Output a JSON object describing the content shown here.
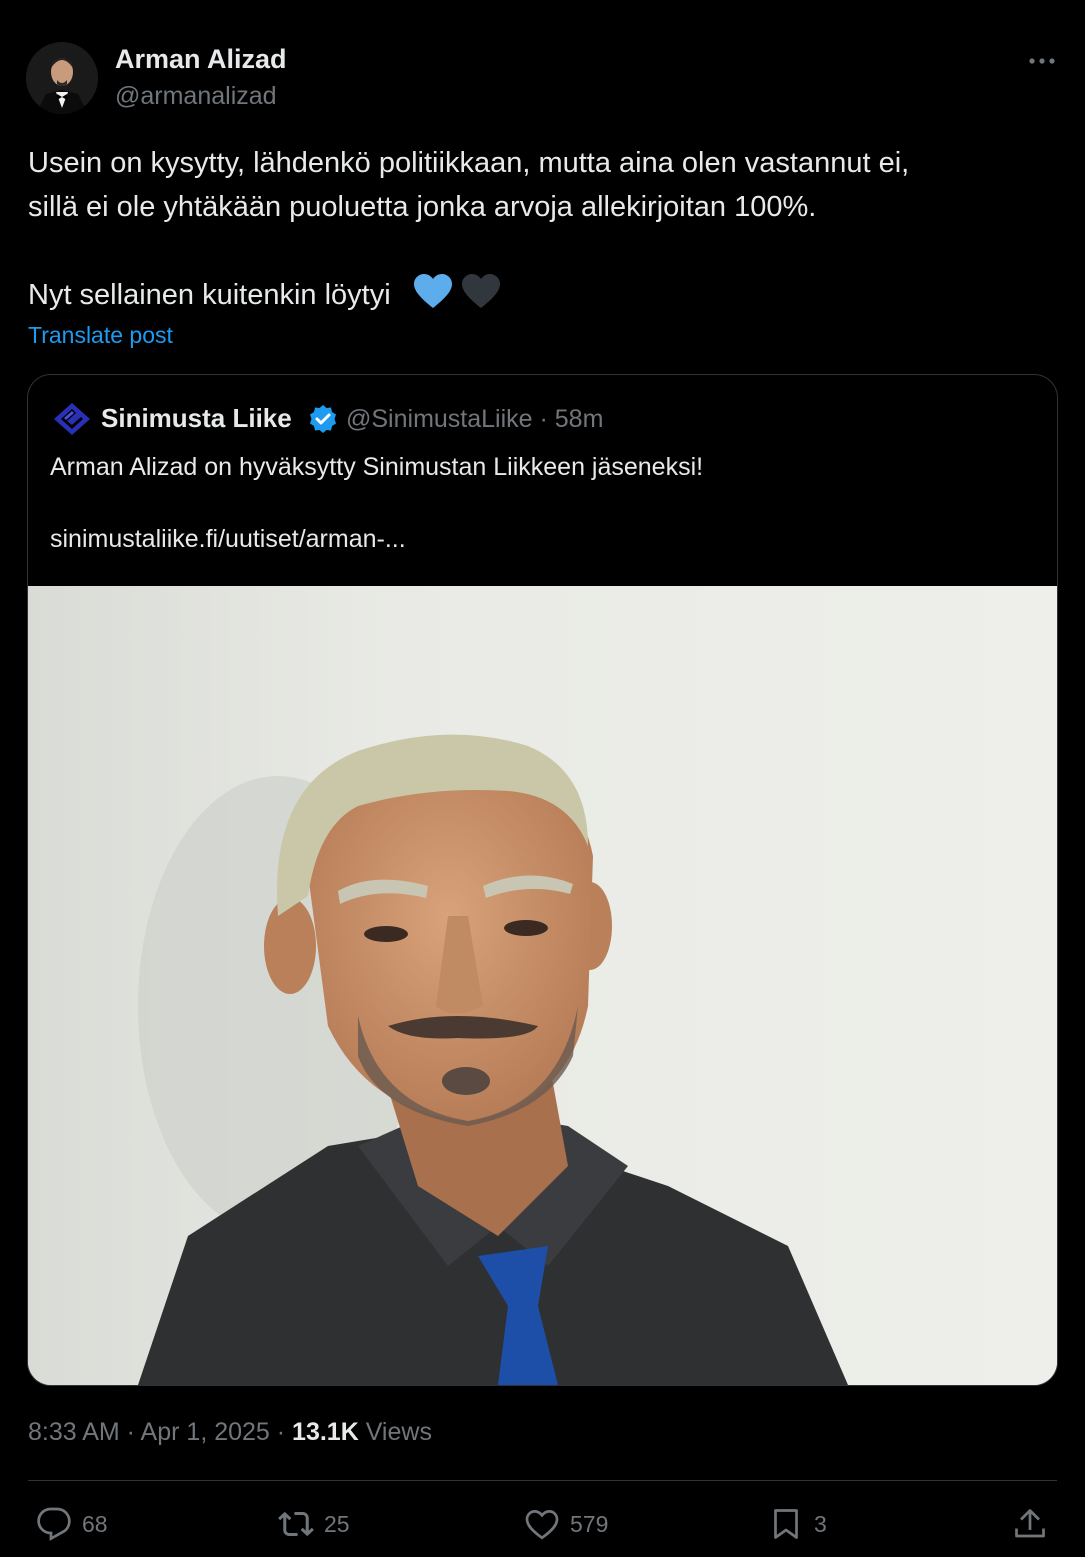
{
  "author": {
    "name": "Arman Alizad",
    "handle": "@armanalizad"
  },
  "post": {
    "lines": [
      "Usein on kysytty, lähdenkö politiikkaan, mutta aina olen vastannut ei,",
      "sillä ei ole yhtäkään puoluetta jonka arvoja allekirjoitan 100%.",
      "Nyt sellainen kuitenkin löytyi"
    ],
    "emoji": "💙🖤",
    "translate_label": "Translate post"
  },
  "quote": {
    "name": "Sinimusta Liike",
    "handle_time": "@SinimustaLiike · 58m",
    "text": "Arman Alizad on hyväksytty Sinimustan Liikkeen jäseneksi!",
    "link": "sinimustaliike.fi/uutiset/arman-..."
  },
  "meta": {
    "time_date": "8:33 AM · Apr 1, 2025 · ",
    "views_count": "13.1K",
    "views_label": " Views"
  },
  "actions": {
    "replies": "68",
    "reposts": "25",
    "likes": "579",
    "bookmarks": "3"
  },
  "icons": [
    "more-icon",
    "verified-badge-icon",
    "sinimusta-logo-icon",
    "reply-icon",
    "repost-icon",
    "like-icon",
    "bookmark-icon",
    "share-icon"
  ],
  "colors": {
    "background": "#000000",
    "text": "#e7e9ea",
    "muted": "#71767b",
    "link": "#1d9bf0",
    "verified": "#1d9bf0",
    "border": "#2f3336"
  }
}
